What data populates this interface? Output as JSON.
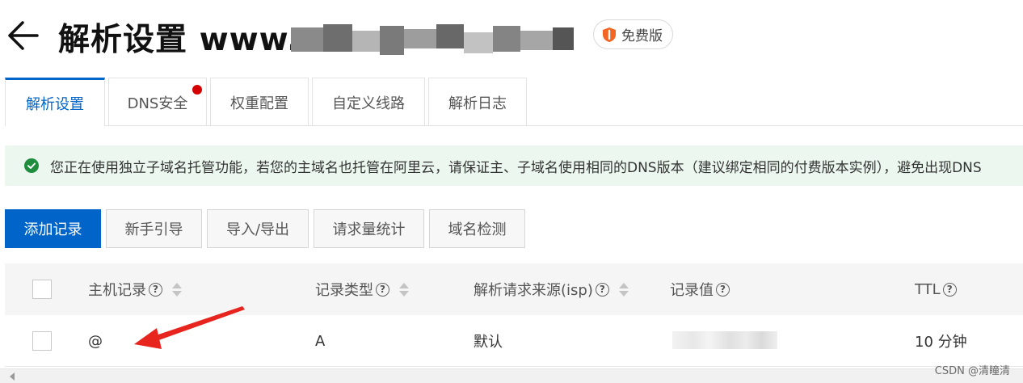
{
  "header": {
    "back_icon": "arrow-left-icon",
    "title": "解析设置 www.",
    "domain_suffix": "c",
    "edition_label": "免费版",
    "edition_icon": "shield-icon",
    "edition_color": "#f26522"
  },
  "tabs": [
    {
      "label": "解析设置",
      "active": true
    },
    {
      "label": "DNS安全",
      "badge_dot": true
    },
    {
      "label": "权重配置"
    },
    {
      "label": "自定义线路"
    },
    {
      "label": "解析日志"
    }
  ],
  "notice": {
    "icon": "check-circle-icon",
    "text": "您正在使用独立子域名托管功能，若您的主域名也托管在阿里云，请保证主、子域名使用相同的DNS版本（建议绑定相同的付费版本实例），避免出现DNS"
  },
  "toolbar": {
    "add_record": "添加记录",
    "guide": "新手引导",
    "import_export": "导入/导出",
    "request_stats": "请求量统计",
    "domain_check": "域名检测"
  },
  "table": {
    "columns": {
      "host": "主机记录",
      "type": "记录类型",
      "isp": "解析请求来源(isp)",
      "value": "记录值",
      "ttl": "TTL"
    },
    "rows": [
      {
        "host": "@",
        "type": "A",
        "isp": "默认",
        "value": "",
        "ttl": "10 分钟"
      }
    ]
  },
  "watermark": "CSDN @清瞳清",
  "colors": {
    "primary": "#0064c8",
    "notice_bg": "#ecf8ef",
    "success": "#1e8e3e",
    "badge_dot": "#d50000",
    "annotation": "#e8241f"
  }
}
